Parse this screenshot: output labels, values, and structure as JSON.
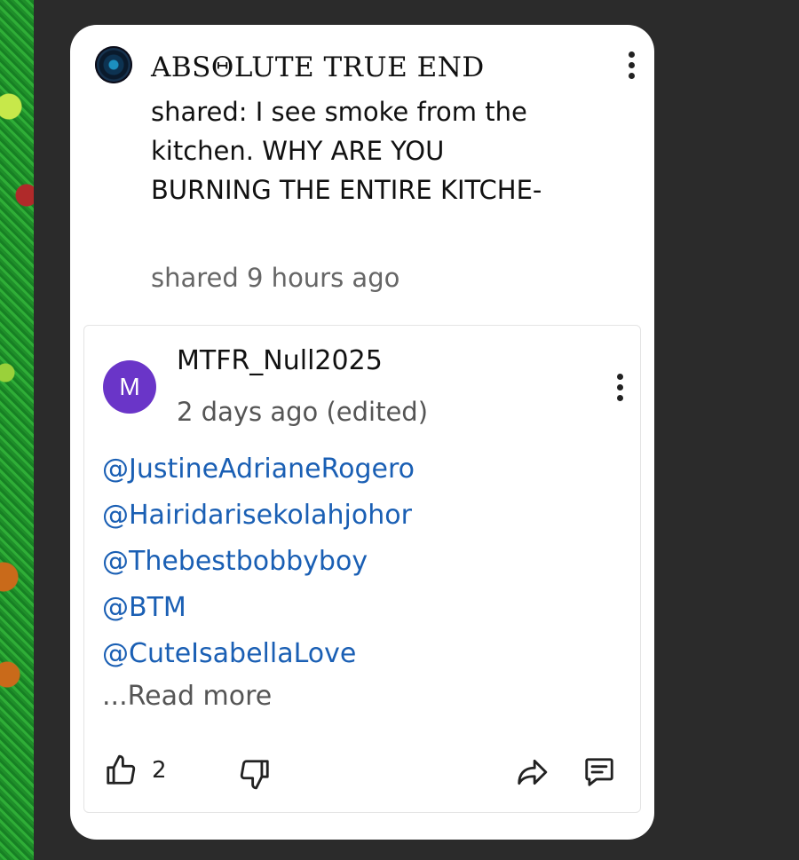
{
  "post": {
    "title": "ABSΘLUTE TRUE END",
    "body": "shared: I see smoke from the kitchen. WHY ARE YOU BURNING THE ENTIRE KITCHE-",
    "timestamp": "shared 9 hours ago",
    "avatar_icon": "profile-picture",
    "menu_icon": "more-vertical-icon"
  },
  "comment": {
    "avatar_letter": "M",
    "avatar_color": "#6a35c8",
    "username": "MTFR_Null2025",
    "timestamp": "2 days ago (edited)",
    "mentions": [
      "@JustineAdrianeRogero",
      "@Hairidarisekolahjohor",
      "@Thebestbobbyboy",
      "@BTM",
      "@CuteIsabellaLove"
    ],
    "read_more": "...Read more",
    "likes": "2",
    "mention_color": "#1a5fb4",
    "actions": {
      "like_icon": "thumbs-up-icon",
      "dislike_icon": "thumbs-down-icon",
      "share_icon": "share-icon",
      "reply_icon": "comment-icon"
    }
  }
}
